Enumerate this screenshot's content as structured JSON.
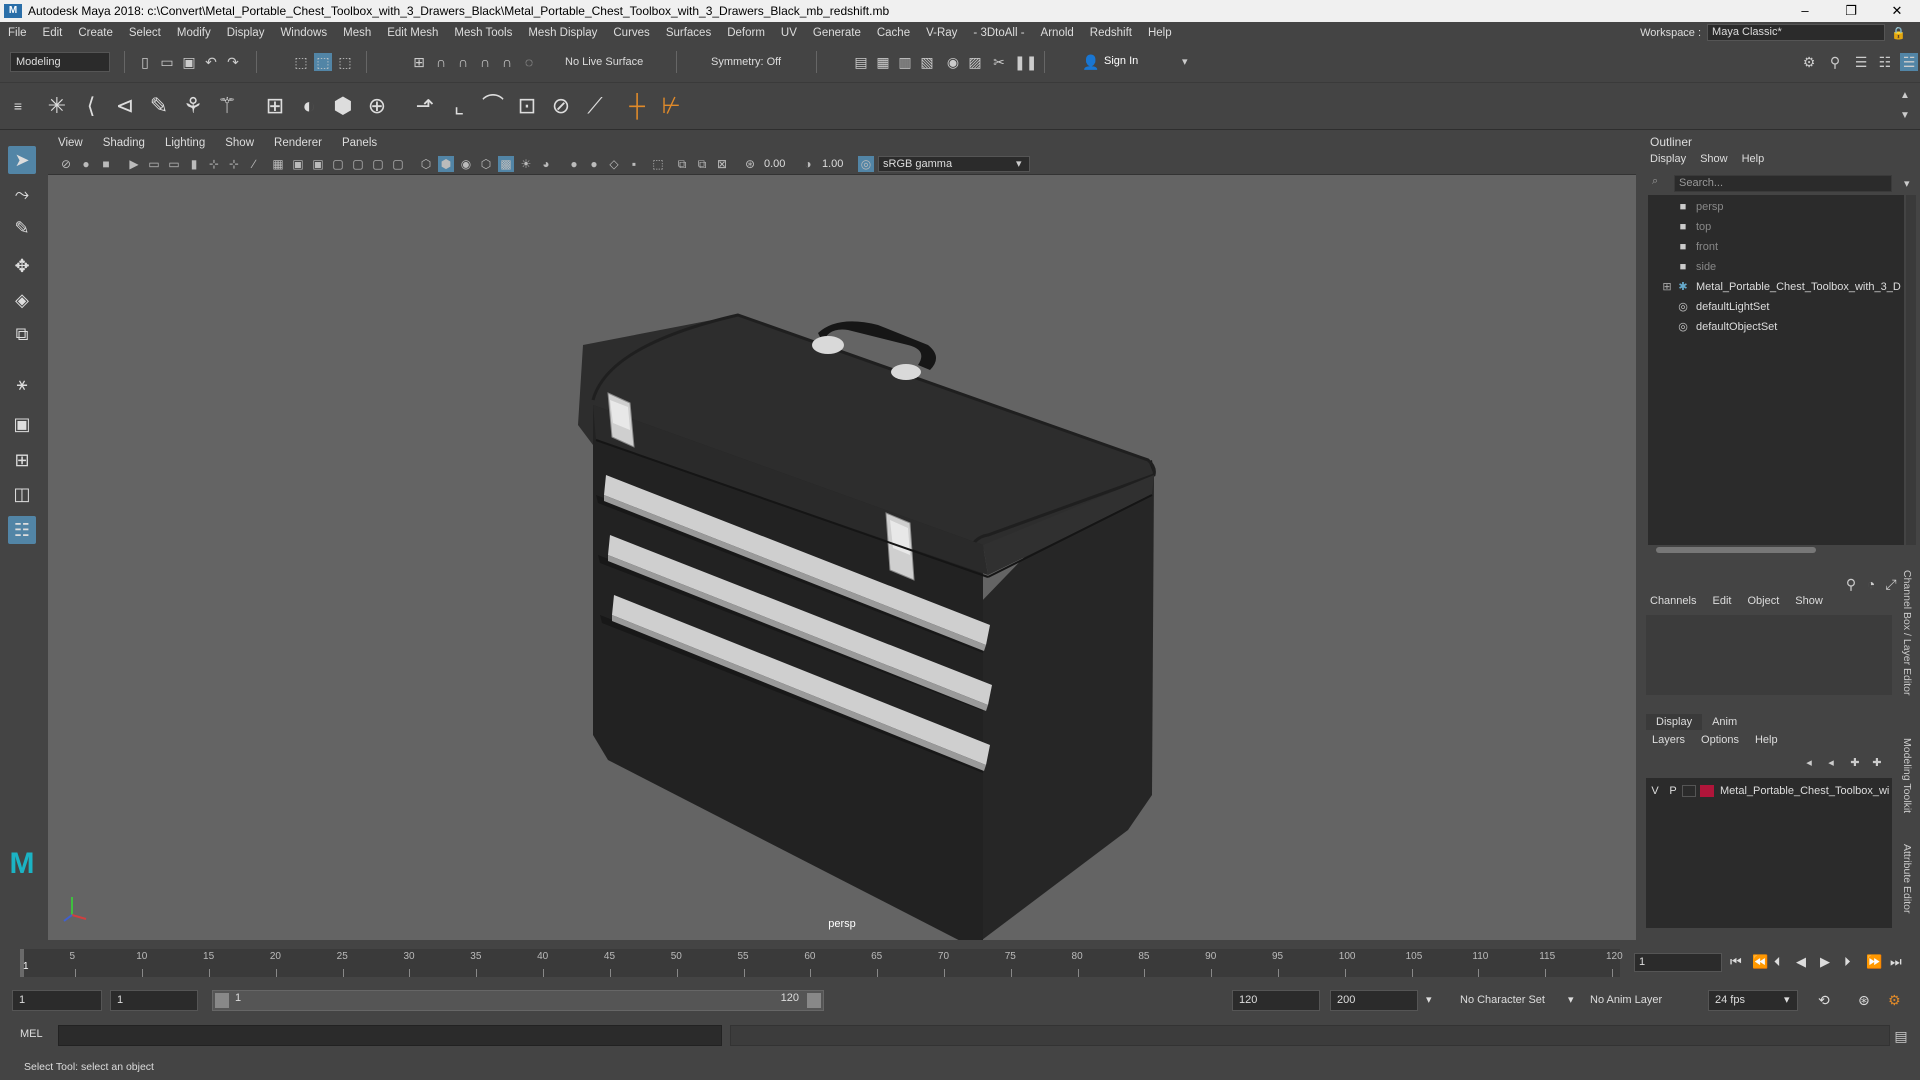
{
  "window": {
    "title": "Autodesk Maya 2018: c:\\Convert\\Metal_Portable_Chest_Toolbox_with_3_Drawers_Black\\Metal_Portable_Chest_Toolbox_with_3_Drawers_Black_mb_redshift.mb",
    "logo": "M",
    "controls": [
      "–",
      "❐",
      "✕"
    ]
  },
  "menubar": {
    "items": [
      "File",
      "Edit",
      "Create",
      "Select",
      "Modify",
      "Display",
      "Windows",
      "Mesh",
      "Edit Mesh",
      "Mesh Tools",
      "Mesh Display",
      "Curves",
      "Surfaces",
      "Deform",
      "UV",
      "Generate",
      "Cache",
      "V-Ray",
      "- 3DtoAll -",
      "Arnold",
      "Redshift",
      "Help"
    ],
    "workspace_label": "Workspace :",
    "workspace_value": "Maya Classic*"
  },
  "statusline": {
    "menuset": "Modeling",
    "live_surface": "No Live Surface",
    "symmetry": "Symmetry: Off",
    "sign_in": "Sign In"
  },
  "viewport": {
    "menus": [
      "View",
      "Shading",
      "Lighting",
      "Show",
      "Renderer",
      "Panels"
    ],
    "exposure": "0.00",
    "gamma": "1.00",
    "color_space": "sRGB gamma",
    "camera": "persp"
  },
  "outliner": {
    "title": "Outliner",
    "menus": [
      "Display",
      "Show",
      "Help"
    ],
    "search_placeholder": "Search...",
    "items": [
      {
        "label": "persp",
        "icon": "camera-icon",
        "dim": true
      },
      {
        "label": "top",
        "icon": "camera-icon",
        "dim": true
      },
      {
        "label": "front",
        "icon": "camera-icon",
        "dim": true
      },
      {
        "label": "side",
        "icon": "camera-icon",
        "dim": true
      },
      {
        "label": "Metal_Portable_Chest_Toolbox_with_3_D",
        "icon": "group-icon",
        "dim": false
      },
      {
        "label": "defaultLightSet",
        "icon": "set-icon",
        "dim": false
      },
      {
        "label": "defaultObjectSet",
        "icon": "set-icon",
        "dim": false
      }
    ]
  },
  "channelbox": {
    "menus": [
      "Channels",
      "Edit",
      "Object",
      "Show"
    ]
  },
  "layereditor": {
    "tabs": [
      "Display",
      "Anim"
    ],
    "menus": [
      "Layers",
      "Options",
      "Help"
    ],
    "layer": {
      "v": "V",
      "p": "P",
      "name": "Metal_Portable_Chest_Toolbox_wi",
      "color": "#b0153a"
    }
  },
  "side_tabs": [
    "Channel Box / Layer Editor",
    "Modeling Toolkit",
    "Attribute Editor"
  ],
  "timeslider": {
    "ticks": [
      5,
      10,
      15,
      20,
      25,
      30,
      35,
      40,
      45,
      50,
      55,
      60,
      65,
      70,
      75,
      80,
      85,
      90,
      95,
      100,
      105,
      110,
      115,
      120
    ],
    "current_frame_marker": "1",
    "current_frame": "1"
  },
  "rangeslider": {
    "start": "1",
    "playback_start": "1",
    "range_start_label": "1",
    "range_end_label": "120",
    "playback_end": "120",
    "end": "200",
    "character_set": "No Character Set",
    "anim_layer": "No Anim Layer",
    "fps": "24 fps"
  },
  "cmdline": {
    "label": "MEL"
  },
  "helpline": {
    "text": "Select Tool: select an object"
  },
  "colors": {
    "accent": "#5285a6",
    "panel": "#444444",
    "viewport": "#646464",
    "layer_color": "#b0153a"
  }
}
